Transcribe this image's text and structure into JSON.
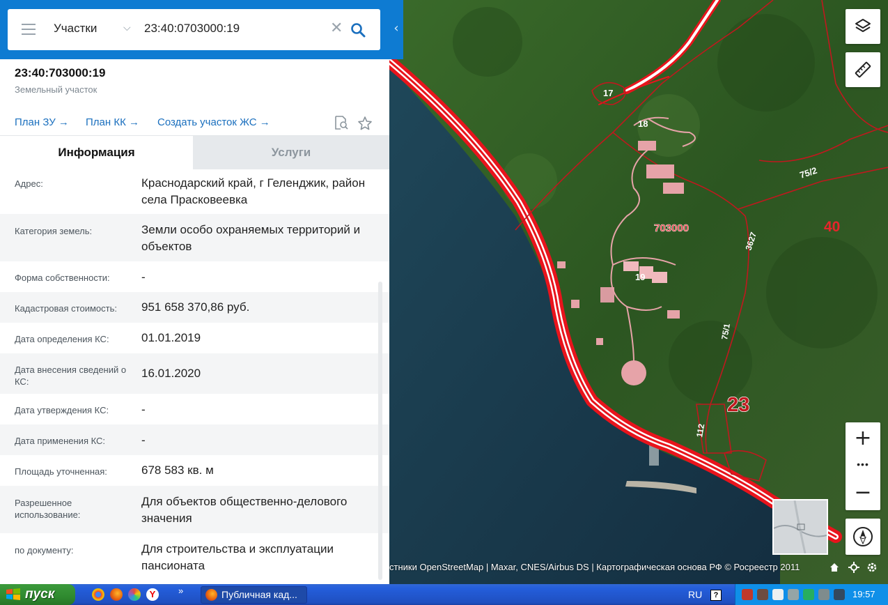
{
  "search": {
    "layer": "Участки",
    "query": "23:40:0703000:19"
  },
  "object": {
    "cadastral_number": "23:40:703000:19",
    "type": "Земельный участок"
  },
  "links": [
    {
      "label": "План ЗУ →"
    },
    {
      "label": "План КК →"
    },
    {
      "label": "Создать участок ЖС →"
    }
  ],
  "tabs": {
    "info": "Информация",
    "services": "Услуги"
  },
  "properties": [
    {
      "label": "Адрес:",
      "value": "Краснодарский край, г Геленджик, район села Прасковеевка"
    },
    {
      "label": "Категория земель:",
      "value": "Земли особо охраняемых территорий и объектов"
    },
    {
      "label": "Форма собственности:",
      "value": "-"
    },
    {
      "label": "Кадастровая стоимость:",
      "value": "951 658 370,86 руб."
    },
    {
      "label": "Дата определения КС:",
      "value": "01.01.2019"
    },
    {
      "label": "Дата внесения сведений о КС:",
      "value": "16.01.2020"
    },
    {
      "label": "Дата утверждения КС:",
      "value": "-"
    },
    {
      "label": "Дата применения КС:",
      "value": "-"
    },
    {
      "label": "Площадь уточненная:",
      "value": "678 583 кв. м"
    },
    {
      "label": "Разрешенное использование:",
      "value": "Для объектов общественно-делового значения"
    },
    {
      "label": "по документу:",
      "value": "Для строительства и эксплуатации пансионата"
    }
  ],
  "map": {
    "labels": {
      "q17": "17",
      "q18": "18",
      "q19": "19",
      "block": "703000",
      "q40": "40",
      "q23": "23",
      "q3627": "3627",
      "q75_2": "75/2",
      "q75_1": "75/1",
      "q112": "112"
    },
    "attribution": "стники OpenStreetMap | Maxar, CNES/Airbus DS | Картографическая основа РФ © Росреестр 2011",
    "boundary_color": "#e8141c",
    "water_color": "#1a3d52",
    "forest_color": "#2f5a23"
  },
  "taskbar": {
    "start": "пуск",
    "window_title": "Публичная кад...",
    "more": "»",
    "language": "RU",
    "help": "?",
    "clock": "19:57"
  }
}
